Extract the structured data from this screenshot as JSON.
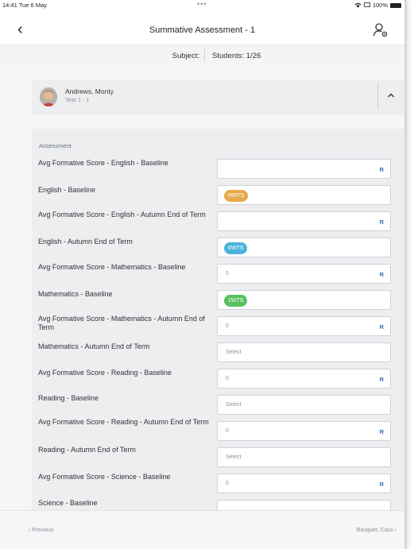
{
  "status_bar": {
    "time": "14:41",
    "date": "Tue 6 May",
    "dots": "•••",
    "battery": "100%"
  },
  "nav": {
    "back_glyph": "‹",
    "title": "Summative Assessment  - 1",
    "settings_icon": "user-settings-icon"
  },
  "subject_bar": {
    "subject_label": "Subject:",
    "students_label": "Students: 1/26"
  },
  "student": {
    "name": "Andrews, Monty",
    "year": "Year 1 - 1"
  },
  "assessment": {
    "section_title": "Assessment",
    "rows": [
      {
        "label": "Avg Formative Score - English - Baseline",
        "value": "",
        "suffix": "R"
      },
      {
        "label": "English - Baseline",
        "badge": "RWTS",
        "badge_color": "#e8a94a"
      },
      {
        "label": "Avg Formative Score - English - Autumn End of Term",
        "value": "",
        "suffix": "R"
      },
      {
        "label": "English - Autumn End of Term",
        "badge": "6WTS",
        "badge_color": "#4bb3dc"
      },
      {
        "label": "Avg Formative Score - Mathematics - Baseline",
        "value": "0",
        "suffix": "R"
      },
      {
        "label": "Mathematics - Baseline",
        "badge": "1WTS",
        "badge_color": "#58c05e"
      },
      {
        "label": "Avg Formative Score - Mathematics - Autumn End of Term",
        "value": "0",
        "suffix": "R"
      },
      {
        "label": "Mathematics - Autumn End of Term",
        "value": "Select"
      },
      {
        "label": "Avg Formative Score - Reading - Baseline",
        "value": "0",
        "suffix": "R"
      },
      {
        "label": "Reading - Baseline",
        "value": "Select"
      },
      {
        "label": "Avg Formative Score - Reading - Autumn End of Term",
        "value": "0",
        "suffix": "R"
      },
      {
        "label": "Reading - Autumn End of Term",
        "value": "Select"
      },
      {
        "label": "Avg Formative Score - Science - Baseline",
        "value": "0",
        "suffix": "R"
      },
      {
        "label": "Science - Baseline",
        "value": ""
      }
    ]
  },
  "footer": {
    "previous_label": "‹  Previous",
    "next_label": "Bouquet, Cass  ›"
  }
}
